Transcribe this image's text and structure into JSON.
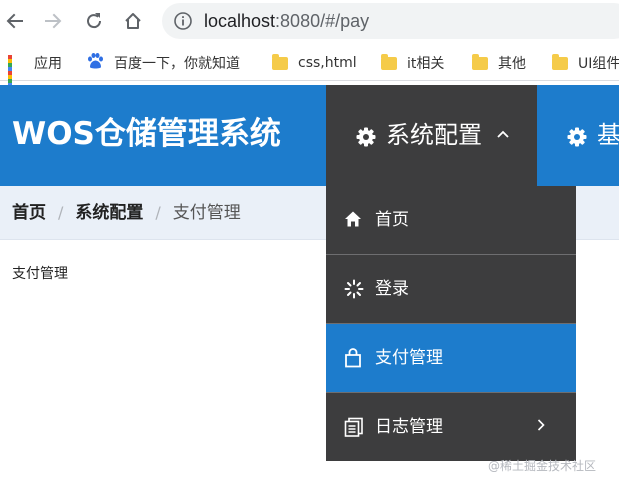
{
  "browser": {
    "url_host": "localhost",
    "url_rest": ":8080/#/pay"
  },
  "bookmarks": [
    {
      "label": "应用",
      "icon": "apps-grid-icon"
    },
    {
      "label": "百度一下，你就知道",
      "icon": "baidu-paw-icon"
    },
    {
      "label": "css,html",
      "icon": "folder-icon"
    },
    {
      "label": "it相关",
      "icon": "folder-icon"
    },
    {
      "label": "其他",
      "icon": "folder-icon"
    },
    {
      "label": "UI组件",
      "icon": "folder-icon"
    }
  ],
  "header": {
    "logo": "WOS仓储管理系统",
    "nav": [
      {
        "label": "系统配置",
        "icon": "gear-icon",
        "expanded": true
      },
      {
        "label": "基础",
        "icon": "gear-icon"
      }
    ]
  },
  "breadcrumb": {
    "items": [
      "首页",
      "系统配置",
      "支付管理"
    ],
    "separator": "/"
  },
  "content": {
    "text": "支付管理"
  },
  "dropdown": {
    "items": [
      {
        "label": "首页",
        "icon": "home-icon"
      },
      {
        "label": "登录",
        "icon": "loading-spinner-icon"
      },
      {
        "label": "支付管理",
        "icon": "shopping-bag-icon",
        "active": true
      },
      {
        "label": "日志管理",
        "icon": "documents-icon",
        "has_submenu": true
      }
    ]
  },
  "watermark": "@稀土掘金技术社区",
  "colors": {
    "accent": "#1d7ccc",
    "menu_dark": "#3d3d3e",
    "breadcrumb_bg": "#eaf0f8"
  }
}
